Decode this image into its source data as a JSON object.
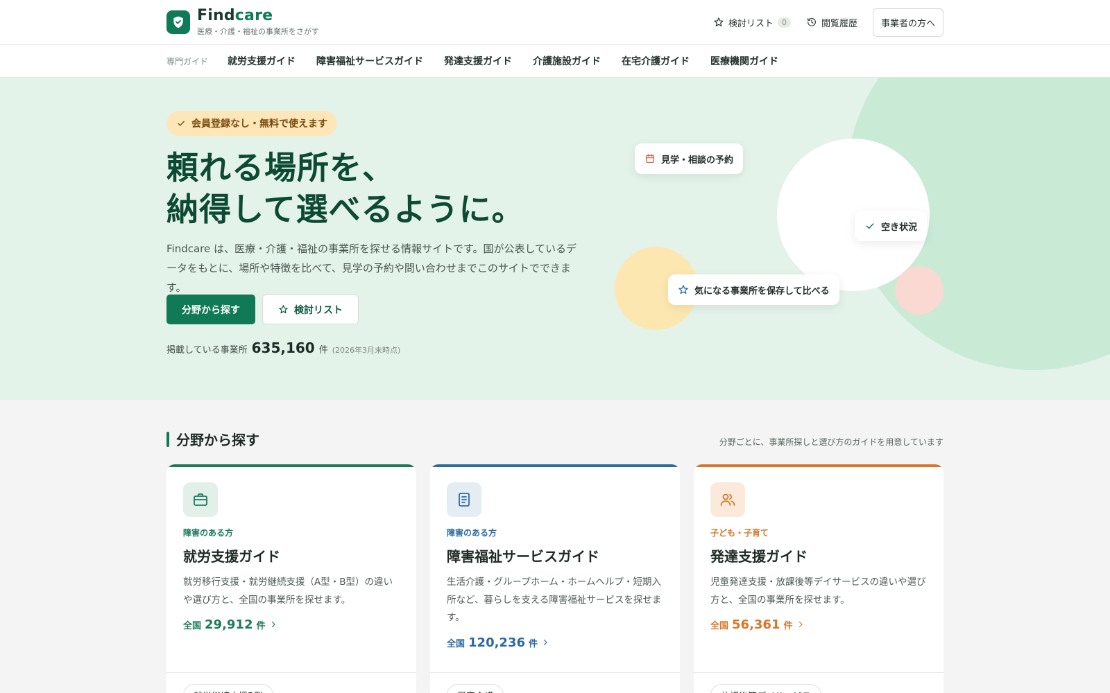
{
  "header": {
    "brand_find": "Find",
    "brand_care": "care",
    "brand_sub": "医療・介護・福祉の事業所をさがす",
    "shortlist_label": "検討リスト",
    "shortlist_count": "0",
    "history_label": "閲覧履歴",
    "business_button": "事業者の方へ"
  },
  "subnav": {
    "label": "専門ガイド",
    "items": [
      "就労支援ガイド",
      "障害福祉サービスガイド",
      "発達支援ガイド",
      "介護施設ガイド",
      "在宅介護ガイド",
      "医療機関ガイド"
    ]
  },
  "hero": {
    "pill": "会員登録なし・無料で使えます",
    "title_line1": "頼れる場所を、",
    "title_line2": "納得して選べるように。",
    "desc": "Findcare は、医療・介護・福祉の事業所を探せる情報サイトです。国が公表しているデータをもとに、場所や特徴を比べて、見学の予約や問い合わせまでこのサイトでできます。",
    "primary_button": "分野から探す",
    "secondary_button": "検討リスト",
    "stats_label": "掲載している事業所",
    "stats_number": "635,160",
    "stats_unit": "件",
    "stats_note": "(2026年3月末時点)",
    "float_reservation": "見学・相談の予約",
    "float_vacancy": "空き状況",
    "float_save": "気になる事業所を保存して比べる"
  },
  "categories": {
    "title": "分野から探す",
    "note": "分野ごとに、事業所探しと選び方のガイドを用意しています",
    "cards": [
      {
        "accent": "#1c7a5c",
        "tag": "障害のある方",
        "title": "就労支援ガイド",
        "desc": "就労移行支援・就労継続支援（A型・B型）の違いや選び方と、全国の事業所を探せます。",
        "count_prefix": "全国",
        "count": "29,912",
        "count_unit": "件",
        "chip": "就労継続支援B型"
      },
      {
        "accent": "#2d6a9f",
        "tag": "障害のある方",
        "title": "障害福祉サービスガイド",
        "desc": "生活介護・グループホーム・ホームヘルプ・短期入所など、暮らしを支える障害福祉サービスを探せます。",
        "count_prefix": "全国",
        "count": "120,236",
        "count_unit": "件",
        "chip": "居宅介護"
      },
      {
        "accent": "#d9762a",
        "tag": "子ども・子育て",
        "title": "発達支援ガイド",
        "desc": "児童発達支援・放課後等デイサービスの違いや選び方と、全国の事業所を探せます。",
        "count_prefix": "全国",
        "count": "56,361",
        "count_unit": "件",
        "chip": "放課後等デイサービス"
      }
    ]
  }
}
